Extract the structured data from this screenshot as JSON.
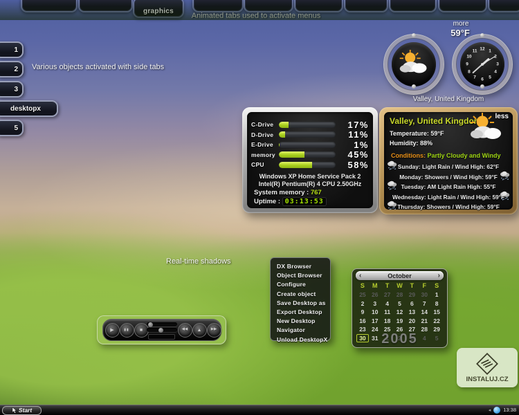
{
  "top_bar": {
    "annotation": "Animated tabs used to activate menus",
    "tabs": [
      {
        "label": "",
        "expanded": false
      },
      {
        "label": "",
        "expanded": false
      },
      {
        "label": "graphics",
        "expanded": true
      },
      {
        "label": "",
        "expanded": false
      },
      {
        "label": "",
        "expanded": false
      },
      {
        "label": "",
        "expanded": false
      },
      {
        "label": "",
        "expanded": false
      },
      {
        "label": "",
        "expanded": false
      },
      {
        "label": "",
        "expanded": false
      },
      {
        "label": "",
        "expanded": false
      }
    ]
  },
  "side_tabs": {
    "annotation": "Various objects activated with side tabs",
    "items": [
      {
        "label": "1",
        "expanded": false
      },
      {
        "label": "2",
        "expanded": false
      },
      {
        "label": "3",
        "expanded": false
      },
      {
        "label": "desktopx",
        "expanded": true
      },
      {
        "label": "5",
        "expanded": false
      }
    ]
  },
  "weather_widget": {
    "more_label": "more",
    "temperature": "59°F",
    "location": "Valley, United Kingdom"
  },
  "clock": {
    "numbers": [
      "12",
      "1",
      "2",
      "3",
      "4",
      "5",
      "6",
      "7",
      "8",
      "9",
      "10",
      "11"
    ]
  },
  "system_monitor": {
    "meters": [
      {
        "label": "C-Drive",
        "value": 17,
        "text": "17%"
      },
      {
        "label": "D-Drive",
        "value": 11,
        "text": "11%"
      },
      {
        "label": "E-Drive",
        "value": 1,
        "text": "1%"
      },
      {
        "label": "memory",
        "value": 45,
        "text": "45%"
      },
      {
        "label": "CPU",
        "value": 58,
        "text": "58%"
      }
    ],
    "os": "Windows XP Home Service Pack 2",
    "cpu": "Intel(R) Pentium(R) 4 CPU 2.50GHz",
    "memory_label": "System memory :",
    "memory_value": "767",
    "uptime_label": "Uptime :",
    "uptime_value": "03:13:53"
  },
  "forecast": {
    "less_label": "less",
    "location": "Valley, United Kingdom",
    "temperature": "Temperature: 59°F",
    "humidity": "Humidity: 88%",
    "conditions_label": "Conditions:",
    "conditions_value": "Partly Cloudy and Windy",
    "days": [
      {
        "text": "Sunday: Light Rain / Wind High: 62°F",
        "icon_side": "left"
      },
      {
        "text": "Monday: Showers / Wind High: 59°F",
        "icon_side": "right"
      },
      {
        "text": "Tuesday: AM Light Rain High: 55°F",
        "icon_side": "left"
      },
      {
        "text": "Wednesday: Light Rain / Wind High: 59°F",
        "icon_side": "right"
      },
      {
        "text": "Thursday: Showers / Wind High: 59°F",
        "icon_side": "left"
      }
    ]
  },
  "shadows_annotation": "Real-time shadows",
  "context_menu": {
    "items": [
      "DX Browser",
      "Object Browser",
      "Configure",
      "Create object",
      "Save Desktop as",
      "Export Desktop",
      "New Desktop",
      "Navigator",
      "Unload DesktopX"
    ]
  },
  "calendar": {
    "month": "October",
    "year": "2005",
    "day_headers": [
      "S",
      "M",
      "T",
      "W",
      "T",
      "F",
      "S"
    ],
    "weeks": [
      [
        {
          "d": "25",
          "muted": true
        },
        {
          "d": "26",
          "muted": true
        },
        {
          "d": "27",
          "muted": true
        },
        {
          "d": "28",
          "muted": true
        },
        {
          "d": "29",
          "muted": true
        },
        {
          "d": "30",
          "muted": true
        },
        {
          "d": "1"
        }
      ],
      [
        {
          "d": "2"
        },
        {
          "d": "3"
        },
        {
          "d": "4"
        },
        {
          "d": "5"
        },
        {
          "d": "6"
        },
        {
          "d": "7"
        },
        {
          "d": "8"
        }
      ],
      [
        {
          "d": "9"
        },
        {
          "d": "10"
        },
        {
          "d": "11"
        },
        {
          "d": "12"
        },
        {
          "d": "13"
        },
        {
          "d": "14"
        },
        {
          "d": "15"
        }
      ],
      [
        {
          "d": "16"
        },
        {
          "d": "17"
        },
        {
          "d": "18"
        },
        {
          "d": "19"
        },
        {
          "d": "20"
        },
        {
          "d": "21"
        },
        {
          "d": "22"
        }
      ],
      [
        {
          "d": "23"
        },
        {
          "d": "24"
        },
        {
          "d": "25"
        },
        {
          "d": "26"
        },
        {
          "d": "27"
        },
        {
          "d": "28"
        },
        {
          "d": "29"
        }
      ],
      [
        {
          "d": "30",
          "selected": true
        },
        {
          "d": "31"
        },
        {
          "d": "1",
          "muted": true
        },
        {
          "d": "2",
          "muted": true
        },
        {
          "d": "3",
          "muted": true
        },
        {
          "d": "4",
          "muted": true
        },
        {
          "d": "5",
          "muted": true
        }
      ]
    ]
  },
  "media_player": {
    "buttons": [
      "play",
      "pause",
      "stop",
      "rewind",
      "eject",
      "fast_forward"
    ]
  },
  "taskbar": {
    "start_label": "Start",
    "time": "13:38"
  },
  "watermark": {
    "text": "INSTALUJ.CZ"
  },
  "icons": {
    "play": "▶",
    "pause": "▮▮",
    "stop": "■",
    "rewind": "◀◀",
    "eject": "▲",
    "fast_forward": "▶▶",
    "calendar_prev": "‹",
    "calendar_next": "›",
    "tray_collapse": "◂"
  },
  "colors": {
    "accent_green": "#a8cf1d",
    "value_green": "#b8e018",
    "calendar_accent": "#b6cc2e",
    "forecast_location": "#c9d92b",
    "conditions_label": "#e89018",
    "conditions_value": "#9ed414",
    "gold_frame": "#ad8a4e",
    "silver_frame": "#b5b5b5"
  }
}
